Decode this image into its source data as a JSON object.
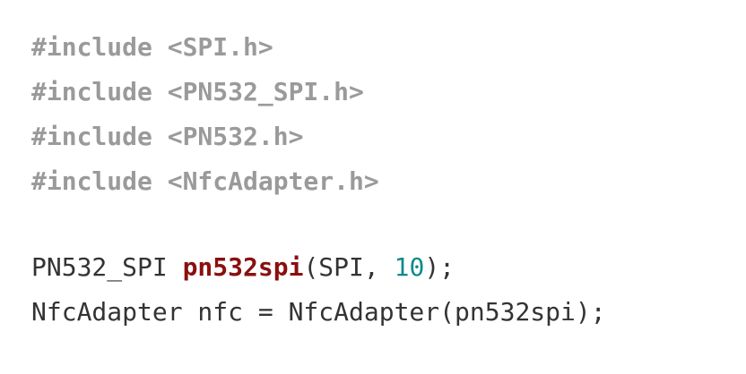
{
  "includes": [
    "#include <SPI.h>",
    "#include <PN532_SPI.h>",
    "#include <PN532.h>",
    "#include <NfcAdapter.h>"
  ],
  "declaration1": {
    "type": "PN532_SPI ",
    "name": "pn532spi",
    "args_open": "(SPI, ",
    "number": "10",
    "args_close": ");"
  },
  "declaration2": {
    "text": "NfcAdapter nfc = NfcAdapter(pn532spi);"
  },
  "colors": {
    "preprocessor": "#9a9a9a",
    "function_name": "#8b0f0f",
    "number_literal": "#0e8a8a",
    "default_text": "#333333",
    "background": "#ffffff"
  }
}
